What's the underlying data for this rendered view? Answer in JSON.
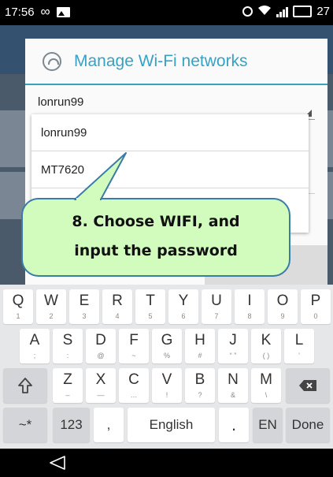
{
  "status_bar": {
    "time": "17:56",
    "battery": "27",
    "icons": [
      "infinity-icon",
      "image-icon",
      "alarm-icon",
      "wifi-icon",
      "signal-icon",
      "battery-icon"
    ]
  },
  "dialog": {
    "title": "Manage Wi-Fi networks",
    "selected_network": "lonrun99",
    "accent_color": "#37a2c4"
  },
  "dropdown": {
    "items": [
      "lonrun99",
      "MT7620"
    ]
  },
  "callout": {
    "line1": "8. Choose WIFI, and",
    "line2": "input the password",
    "fill_color": "#d2fbbe",
    "border_color": "#3a7ba8"
  },
  "keyboard": {
    "row1": [
      {
        "main": "Q",
        "sub": "1"
      },
      {
        "main": "W",
        "sub": "2"
      },
      {
        "main": "E",
        "sub": "3"
      },
      {
        "main": "R",
        "sub": "4"
      },
      {
        "main": "T",
        "sub": "5"
      },
      {
        "main": "Y",
        "sub": "6"
      },
      {
        "main": "U",
        "sub": "7"
      },
      {
        "main": "I",
        "sub": "8"
      },
      {
        "main": "O",
        "sub": "9"
      },
      {
        "main": "P",
        "sub": "0"
      }
    ],
    "row2": [
      {
        "main": "A",
        "sub": ";"
      },
      {
        "main": "S",
        "sub": ":"
      },
      {
        "main": "D",
        "sub": "@"
      },
      {
        "main": "F",
        "sub": "~"
      },
      {
        "main": "G",
        "sub": "%"
      },
      {
        "main": "H",
        "sub": "#"
      },
      {
        "main": "J",
        "sub": "“ ”"
      },
      {
        "main": "K",
        "sub": "( )"
      },
      {
        "main": "L",
        "sub": "’"
      }
    ],
    "row3": [
      {
        "main": "Z",
        "sub": "–"
      },
      {
        "main": "X",
        "sub": "—"
      },
      {
        "main": "C",
        "sub": "…"
      },
      {
        "main": "V",
        "sub": "!"
      },
      {
        "main": "B",
        "sub": "?"
      },
      {
        "main": "N",
        "sub": "&"
      },
      {
        "main": "M",
        "sub": "\\"
      }
    ],
    "shift_icon": "shift-up-icon",
    "delete_icon": "backspace-icon",
    "symbols_label": "~*",
    "numbers_label": "123",
    "comma_label": ",",
    "space_label": "English",
    "period_label": ".",
    "lang_label": "EN",
    "done_label": "Done"
  },
  "nav_bar": {
    "back_icon": "back-triangle-icon"
  }
}
